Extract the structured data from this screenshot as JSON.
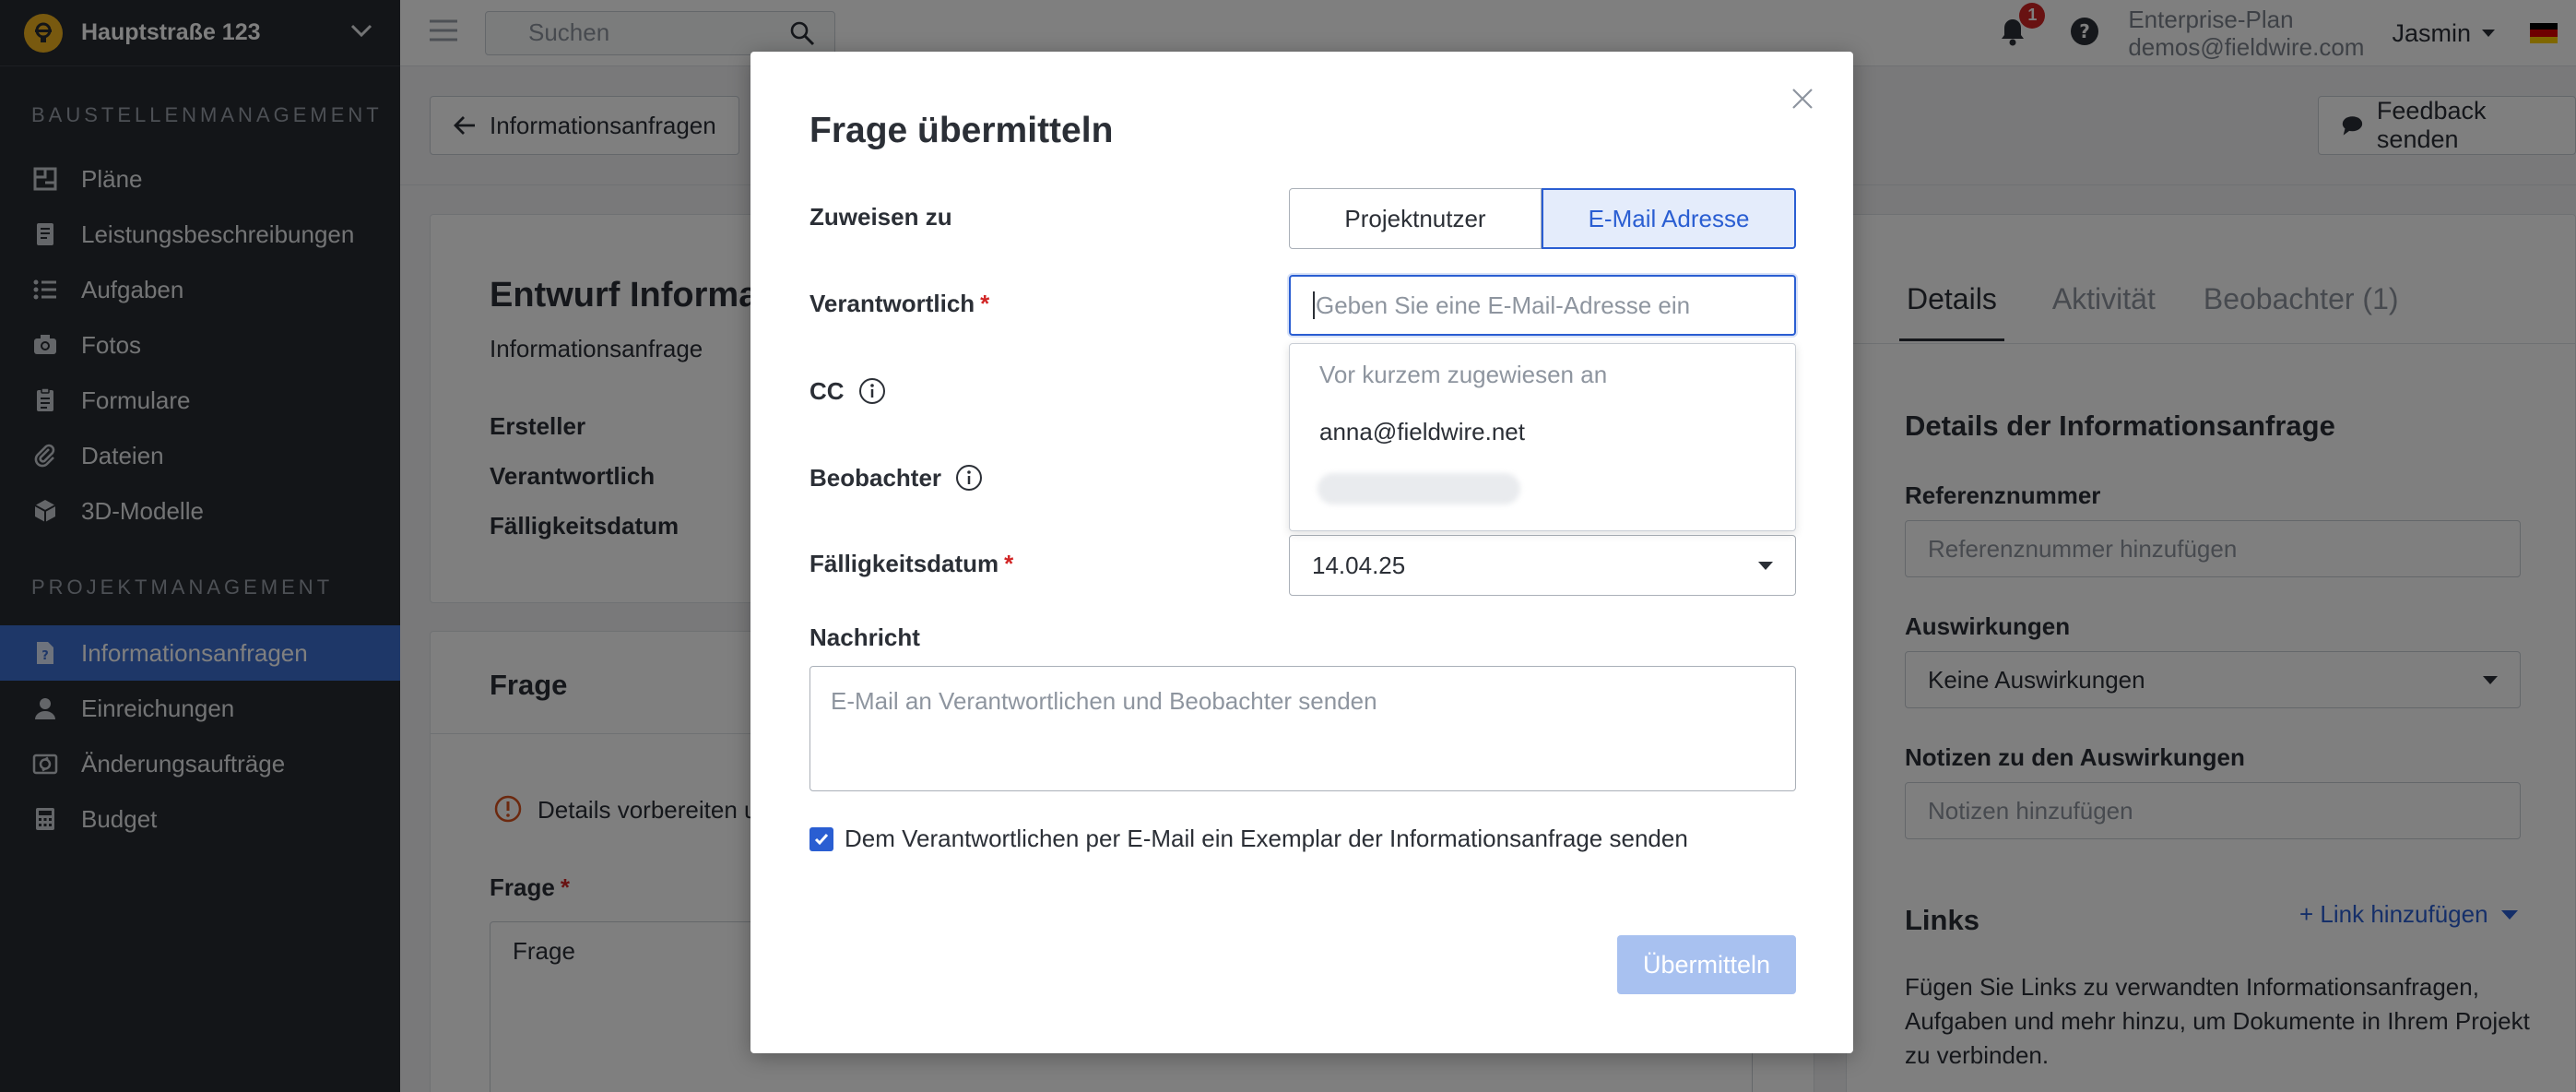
{
  "sidebar": {
    "project": "Hauptstraße 123",
    "sections": [
      {
        "title": "BAUSTELLENMANAGEMENT"
      },
      {
        "title": "PROJEKTMANAGEMENT"
      }
    ],
    "items": [
      {
        "label": "Pläne",
        "icon": "plans-icon"
      },
      {
        "label": "Leistungsbeschreibungen",
        "icon": "specs-icon"
      },
      {
        "label": "Aufgaben",
        "icon": "tasks-icon"
      },
      {
        "label": "Fotos",
        "icon": "camera-icon"
      },
      {
        "label": "Formulare",
        "icon": "forms-icon"
      },
      {
        "label": "Dateien",
        "icon": "paperclip-icon"
      },
      {
        "label": "3D-Modelle",
        "icon": "cube-icon"
      },
      {
        "label": "Informationsanfragen",
        "icon": "rfi-icon",
        "active": true
      },
      {
        "label": "Einreichungen",
        "icon": "person-icon"
      },
      {
        "label": "Änderungsaufträge",
        "icon": "change-order-icon"
      },
      {
        "label": "Budget",
        "icon": "calculator-icon"
      }
    ]
  },
  "topbar": {
    "search_placeholder": "Suchen",
    "notification_count": "1",
    "plan": "Enterprise-Plan",
    "email": "demos@fieldwire.com",
    "user": "Jasmin"
  },
  "page": {
    "back_label": "Informationsanfragen",
    "feedback_label": "Feedback senden",
    "draft_title": "Entwurf Informa",
    "draft_sub": "Informationsanfrage",
    "fields": [
      "Ersteller",
      "Verantwortlich",
      "Fälligkeitsdatum"
    ],
    "question_heading": "Frage",
    "warning": "Details vorbereiten u",
    "question_label": "Frage",
    "question_value": "Frage"
  },
  "right_panel": {
    "tabs": [
      "Details",
      "Aktivität",
      "Beobachter (1)"
    ],
    "details_heading": "Details der Informationsanfrage",
    "ref_label": "Referenznummer",
    "ref_placeholder": "Referenznummer hinzufügen",
    "impact_label": "Auswirkungen",
    "impact_value": "Keine Auswirkungen",
    "impact_notes_label": "Notizen zu den Auswirkungen",
    "impact_notes_placeholder": "Notizen hinzufügen",
    "links_heading": "Links",
    "add_link": "+ Link hinzufügen",
    "links_text_1": "Fügen Sie Links zu verwandten Informationsanfragen,",
    "links_text_2": "Aufgaben und mehr hinzu, um Dokumente in Ihrem Projekt",
    "links_text_3": "zu verbinden."
  },
  "modal": {
    "title": "Frage übermitteln",
    "assign_label": "Zuweisen zu",
    "assign_options": [
      "Projektnutzer",
      "E-Mail Adresse"
    ],
    "assign_selected": "E-Mail Adresse",
    "responsible_label": "Verantwortlich",
    "responsible_placeholder": "Geben Sie eine E-Mail-Adresse ein",
    "cc_label": "CC",
    "watchers_label": "Beobachter",
    "dropdown_heading": "Vor kurzem zugewiesen an",
    "dropdown_items": [
      "anna@fieldwire.net"
    ],
    "due_label": "Fälligkeitsdatum",
    "due_value": "14.04.25",
    "message_label": "Nachricht",
    "message_placeholder": "E-Mail an Verantwortlichen und Beobachter senden",
    "checkbox_label": "Dem Verantwortlichen per E-Mail ein Exemplar der Informationsanfrage senden",
    "checkbox_checked": true,
    "submit_label": "Übermitteln",
    "required_mark": "*"
  },
  "colors": {
    "sidebar_bg": "#262a30",
    "active_item": "#3d6ed1",
    "accent": "#2a5ed2",
    "submit_disabled": "#a8c1f0",
    "badge": "#d12525"
  }
}
